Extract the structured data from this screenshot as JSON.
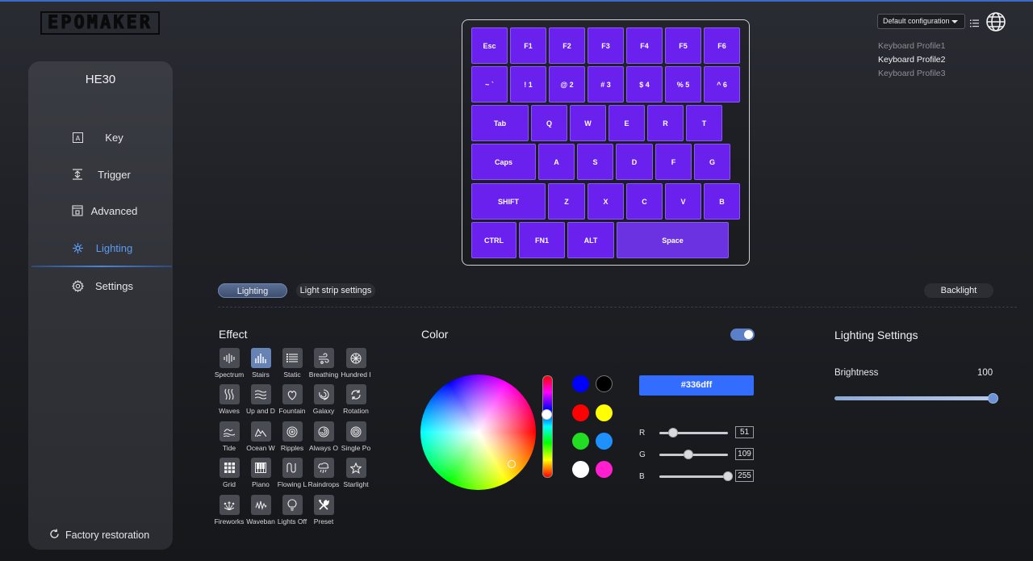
{
  "brand": {
    "logo_text": "EPOMAKER"
  },
  "sidebar": {
    "device_name": "HE30",
    "items": [
      {
        "label": "Key",
        "icon": "key-icon"
      },
      {
        "label": "Trigger",
        "icon": "trigger-icon"
      },
      {
        "label": "Advanced",
        "icon": "advanced-icon"
      },
      {
        "label": "Lighting",
        "icon": "lighting-icon",
        "active": true
      },
      {
        "label": "Settings",
        "icon": "gear-icon"
      }
    ],
    "factory_label": "Factory restoration"
  },
  "keyboard": {
    "rows": [
      [
        "Esc",
        "F1",
        "F2",
        "F3",
        "F4",
        "F5",
        "F6"
      ],
      [
        "~ `",
        "! 1",
        "@ 2",
        "# 3",
        "$ 4",
        "% 5",
        "^ 6"
      ],
      [
        "Tab",
        "Q",
        "W",
        "E",
        "R",
        "T"
      ],
      [
        "Caps",
        "A",
        "S",
        "D",
        "F",
        "G"
      ],
      [
        "SHIFT",
        "Z",
        "X",
        "C",
        "V",
        "B"
      ],
      [
        "CTRL",
        "FN1",
        "ALT",
        "Space"
      ]
    ],
    "key_color": "#6a21ee"
  },
  "header": {
    "config_select": "Default configuration",
    "profiles": [
      "Keyboard Profile1",
      "Keyboard Profile2",
      "Keyboard Profile3"
    ],
    "selected_profile": "Keyboard Profile2"
  },
  "tabs": {
    "lighting": "Lighting",
    "light_strip": "Light strip settings",
    "backlight": "Backlight"
  },
  "effect": {
    "title": "Effect",
    "items": [
      "Spectrum",
      "Stairs",
      "Static",
      "Breathing",
      "Hundred I",
      "Waves",
      "Up and D",
      "Fountain",
      "Galaxy",
      "Rotation",
      "Tide",
      "Ocean W",
      "Ripples",
      "Always O",
      "Single Po",
      "Grid",
      "Piano",
      "Flowing L",
      "Raindrops",
      "Starlight",
      "Fireworks",
      "Waveban",
      "Lights Off",
      "Preset"
    ],
    "selected": "Stairs"
  },
  "color": {
    "title": "Color",
    "toggle_on": true,
    "hex": "#336dff",
    "swatches": [
      "#0000ff",
      "#000000",
      "#ff0000",
      "#ffff00",
      "#22dd22",
      "#1e90ff",
      "#ffffff",
      "#ff1fcf"
    ],
    "rgb": {
      "r_label": "R",
      "g_label": "G",
      "b_label": "B",
      "r": "51",
      "g": "109",
      "b": "255"
    }
  },
  "lighting_settings": {
    "title": "Lighting Settings",
    "brightness_label": "Brightness",
    "brightness_value": "100"
  }
}
